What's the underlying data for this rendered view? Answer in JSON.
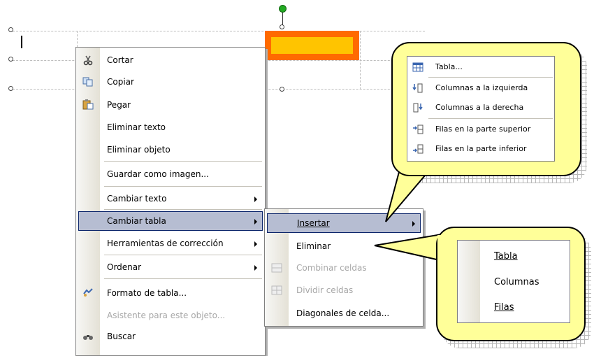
{
  "canvas": {
    "accent_fill": "#ffc400",
    "accent_border": "#ff6a00",
    "rotate_handle_color": "#22aa22"
  },
  "context_menu": {
    "items": [
      {
        "label": "Cortar",
        "icon": "scissors-icon",
        "disabled": false
      },
      {
        "label": "Copiar",
        "icon": "copy-icon",
        "disabled": false
      },
      {
        "label": "Pegar",
        "icon": "paste-icon",
        "disabled": false
      },
      {
        "label": "Eliminar texto",
        "icon": "",
        "disabled": false
      },
      {
        "label": "Eliminar objeto",
        "icon": "",
        "disabled": false
      },
      {
        "label": "Guardar como imagen...",
        "icon": "",
        "disabled": false
      },
      {
        "label": "Cambiar texto",
        "icon": "",
        "disabled": false,
        "submenu": true
      },
      {
        "label": "Cambiar tabla",
        "icon": "",
        "disabled": false,
        "submenu": true,
        "highlighted": true
      },
      {
        "label": "Herramientas de corrección",
        "icon": "",
        "disabled": false,
        "submenu": true
      },
      {
        "label": "Ordenar",
        "icon": "",
        "disabled": false,
        "submenu": true
      },
      {
        "label": "Formato de tabla...",
        "icon": "format-table-icon",
        "disabled": false
      },
      {
        "label": "Asistente para este objeto...",
        "icon": "",
        "disabled": true
      },
      {
        "label": "Buscar",
        "icon": "binoculars-icon",
        "disabled": false
      }
    ]
  },
  "submenu": {
    "items": [
      {
        "label": "Insertar",
        "submenu": true,
        "highlighted": true,
        "icon": ""
      },
      {
        "label": "Eliminar",
        "submenu": true,
        "icon": ""
      },
      {
        "label": "Combinar celdas",
        "disabled": true,
        "icon": "merge-cells-icon"
      },
      {
        "label": "Dividir celdas",
        "disabled": true,
        "icon": "split-cells-icon"
      },
      {
        "label": "Diagonales de celda...",
        "icon": ""
      }
    ]
  },
  "callout_insert": {
    "items": [
      {
        "label": "Tabla...",
        "icon": "table-icon"
      },
      {
        "label": "Columnas a la izquierda",
        "icon": "insert-column-left-icon"
      },
      {
        "label": "Columnas a la derecha",
        "icon": "insert-column-right-icon"
      },
      {
        "label": "Filas en la parte superior",
        "icon": "insert-row-above-icon"
      },
      {
        "label": "Filas en la parte inferior",
        "icon": "insert-row-below-icon"
      }
    ]
  },
  "callout_delete": {
    "items": [
      {
        "label": "Tabla"
      },
      {
        "label": "Columnas"
      },
      {
        "label": "Filas"
      }
    ]
  },
  "colors": {
    "callout_fill": "#ffff99",
    "menu_highlight": "#b6bdd2",
    "menu_highlight_border": "#0a246a"
  }
}
